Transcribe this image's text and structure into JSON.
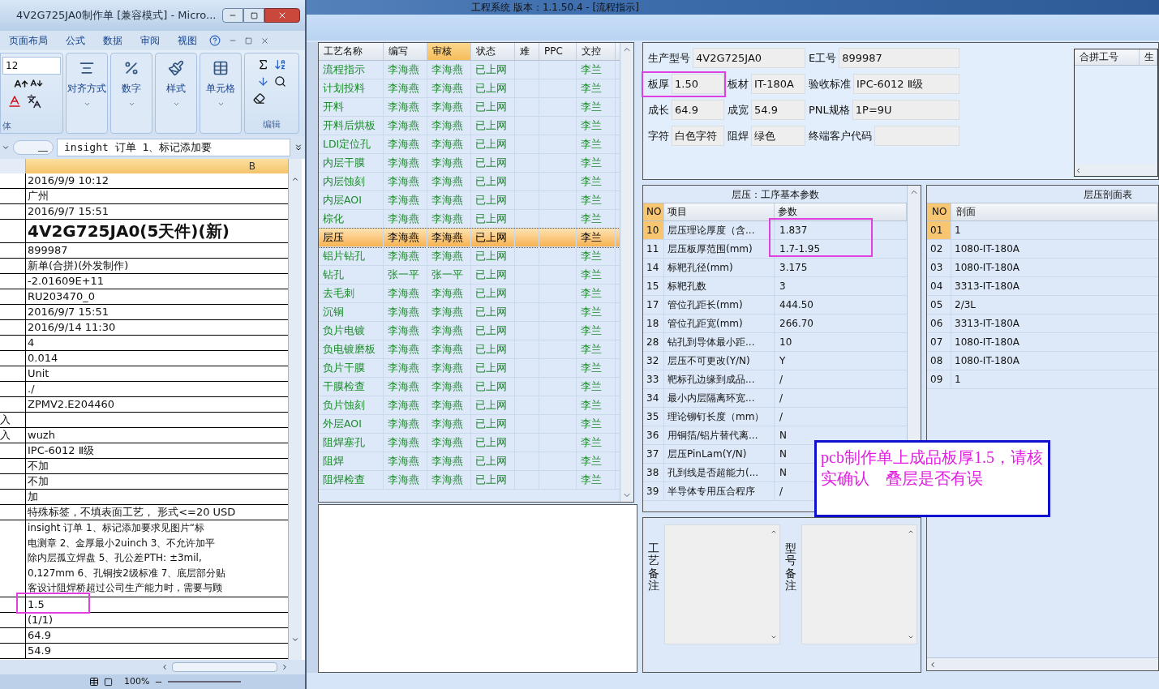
{
  "app": {
    "title": "工程系统   版本：1.1.50.4 - [流程指示]"
  },
  "excel": {
    "title": "4V2G725JA0制作单  [兼容模式]  - Micro...",
    "ribbon_tabs": [
      "页面布局",
      "公式",
      "数据",
      "审阅",
      "视图"
    ],
    "font_size": "12",
    "font_group_label": "体",
    "groups": [
      "对齐方式",
      "数字",
      "样式",
      "单元格"
    ],
    "edit_group_label": "编辑",
    "formula": "insight 订单    1、标记添加要",
    "column_header": "B",
    "zoom": "100%",
    "rows": [
      {
        "kind": "normal",
        "b": "2016/9/9 10:12"
      },
      {
        "kind": "normal",
        "b": "广州"
      },
      {
        "kind": "normal",
        "b": "2016/9/7 15:51"
      },
      {
        "kind": "big",
        "b": "4V2G725JA0(5天件)(新)"
      },
      {
        "kind": "normal",
        "b": "899987"
      },
      {
        "kind": "normal",
        "b": "新单(合拼)(外发制作)"
      },
      {
        "kind": "normal",
        "b": "-2.01609E+11"
      },
      {
        "kind": "normal",
        "b": "RU203470_0"
      },
      {
        "kind": "normal",
        "b": "2016/9/7 15:51"
      },
      {
        "kind": "normal",
        "b": "2016/9/14 11:30"
      },
      {
        "kind": "normal",
        "b": "4"
      },
      {
        "kind": "normal",
        "b": "0.014"
      },
      {
        "kind": "normal",
        "b": "Unit"
      },
      {
        "kind": "normal",
        "b": "./"
      },
      {
        "kind": "normal",
        "b": "ZPMV2.E204460"
      },
      {
        "kind": "normal",
        "a": "入"
      },
      {
        "kind": "normal",
        "a": "入",
        "b": "wuzh"
      },
      {
        "kind": "normal",
        "b": "IPC-6012 Ⅱ级"
      },
      {
        "kind": "normal",
        "b": "不加"
      },
      {
        "kind": "normal",
        "b": "不加"
      },
      {
        "kind": "normal",
        "b": "加"
      },
      {
        "kind": "normal",
        "b": "特殊标签，不填表面工艺，  形式<=20 USD"
      },
      {
        "kind": "multi",
        "lines": [
          "insight 订单    1、标记添加要求见图片“标",
          "电测章  2、金厚最小2uinch  3、不允许加平",
          "除内层孤立焊盘  5、孔公差PTH: ±3mil,",
          "0,127mm  6、孔铜按2级标准  7、底层部分贴",
          "客设计阻焊桥超过公司生产能力时，需要与顾"
        ]
      },
      {
        "kind": "normal",
        "b": "1.5"
      },
      {
        "kind": "normal",
        "b": "(1/1)"
      },
      {
        "kind": "normal",
        "b": "64.9"
      },
      {
        "kind": "normal",
        "b": "54.9"
      }
    ]
  },
  "process_table": {
    "columns": [
      {
        "label": "工艺名称",
        "highlighted": false
      },
      {
        "label": "编写",
        "highlighted": false
      },
      {
        "label": "审核",
        "highlighted": true
      },
      {
        "label": "状态",
        "highlighted": false
      },
      {
        "label": "难",
        "highlighted": false
      },
      {
        "label": "PPC",
        "highlighted": false
      },
      {
        "label": "文控",
        "highlighted": false
      }
    ],
    "rows": [
      {
        "name": "流程指示",
        "writer": "李海燕",
        "reviewer": "李海燕",
        "status": "已上网",
        "doc_control": "李兰",
        "selected": false
      },
      {
        "name": "计划投料",
        "writer": "李海燕",
        "reviewer": "李海燕",
        "status": "已上网",
        "doc_control": "李兰",
        "selected": false
      },
      {
        "name": "开料",
        "writer": "李海燕",
        "reviewer": "李海燕",
        "status": "已上网",
        "doc_control": "李兰",
        "selected": false
      },
      {
        "name": "开料后烘板",
        "writer": "李海燕",
        "reviewer": "李海燕",
        "status": "已上网",
        "doc_control": "李兰",
        "selected": false
      },
      {
        "name": "LDI定位孔",
        "writer": "李海燕",
        "reviewer": "李海燕",
        "status": "已上网",
        "doc_control": "李兰",
        "selected": false
      },
      {
        "name": "内层干膜",
        "writer": "李海燕",
        "reviewer": "李海燕",
        "status": "已上网",
        "doc_control": "李兰",
        "selected": false
      },
      {
        "name": "内层蚀刻",
        "writer": "李海燕",
        "reviewer": "李海燕",
        "status": "已上网",
        "doc_control": "李兰",
        "selected": false
      },
      {
        "name": "内层AOI",
        "writer": "李海燕",
        "reviewer": "李海燕",
        "status": "已上网",
        "doc_control": "李兰",
        "selected": false
      },
      {
        "name": "棕化",
        "writer": "李海燕",
        "reviewer": "李海燕",
        "status": "已上网",
        "doc_control": "李兰",
        "selected": false
      },
      {
        "name": "层压",
        "writer": "李海燕",
        "reviewer": "李海燕",
        "status": "已上网",
        "doc_control": "李兰",
        "selected": true
      },
      {
        "name": "铝片钻孔",
        "writer": "李海燕",
        "reviewer": "李海燕",
        "status": "已上网",
        "doc_control": "李兰",
        "selected": false
      },
      {
        "name": "钻孔",
        "writer": "张一平",
        "reviewer": "张一平",
        "status": "已上网",
        "doc_control": "李兰",
        "selected": false
      },
      {
        "name": "去毛刺",
        "writer": "李海燕",
        "reviewer": "李海燕",
        "status": "已上网",
        "doc_control": "李兰",
        "selected": false
      },
      {
        "name": "沉铜",
        "writer": "李海燕",
        "reviewer": "李海燕",
        "status": "已上网",
        "doc_control": "李兰",
        "selected": false
      },
      {
        "name": "负片电镀",
        "writer": "李海燕",
        "reviewer": "李海燕",
        "status": "已上网",
        "doc_control": "李兰",
        "selected": false
      },
      {
        "name": "负电镀磨板",
        "writer": "李海燕",
        "reviewer": "李海燕",
        "status": "已上网",
        "doc_control": "李兰",
        "selected": false
      },
      {
        "name": "负片干膜",
        "writer": "李海燕",
        "reviewer": "李海燕",
        "status": "已上网",
        "doc_control": "李兰",
        "selected": false
      },
      {
        "name": "干膜检查",
        "writer": "李海燕",
        "reviewer": "李海燕",
        "status": "已上网",
        "doc_control": "李兰",
        "selected": false
      },
      {
        "name": "负片蚀刻",
        "writer": "李海燕",
        "reviewer": "李海燕",
        "status": "已上网",
        "doc_control": "李兰",
        "selected": false
      },
      {
        "name": "外层AOI",
        "writer": "李海燕",
        "reviewer": "李海燕",
        "status": "已上网",
        "doc_control": "李兰",
        "selected": false
      },
      {
        "name": "阻焊塞孔",
        "writer": "李海燕",
        "reviewer": "李海燕",
        "status": "已上网",
        "doc_control": "李兰",
        "selected": false
      },
      {
        "name": "阻焊",
        "writer": "李海燕",
        "reviewer": "李海燕",
        "status": "已上网",
        "doc_control": "李兰",
        "selected": false
      },
      {
        "name": "阻焊检查",
        "writer": "李海燕",
        "reviewer": "李海燕",
        "status": "已上网",
        "doc_control": "李兰",
        "selected": false
      }
    ]
  },
  "product_form": {
    "fields": [
      {
        "label": "生产型号",
        "value": "4V2G725JA0"
      },
      {
        "label": "E工号",
        "value": "899987"
      },
      {
        "label": "板厚",
        "value": "1.50"
      },
      {
        "label": "板材",
        "value": "IT-180A"
      },
      {
        "label": "验收标准",
        "value": "IPC-6012 Ⅱ级"
      },
      {
        "label": "成长",
        "value": "64.9"
      },
      {
        "label": "成宽",
        "value": "54.9"
      },
      {
        "label": "PNL规格",
        "value": "1P=9U"
      },
      {
        "label": "字符",
        "value": "白色字符"
      },
      {
        "label": "阻焊",
        "value": "绿色"
      },
      {
        "label": "终端客户代码"
      }
    ],
    "merge_table": {
      "columns": [
        "合拼工号",
        "生"
      ]
    }
  },
  "param_table": {
    "title": "层压：工序基本参数",
    "columns": [
      "NO",
      "项目",
      "参数"
    ],
    "rows": [
      {
        "no": "10",
        "item": "层压理论厚度（含...",
        "value": "1.837",
        "selected": true
      },
      {
        "no": "11",
        "item": "层压板厚范围(mm)",
        "value": "1.7-1.95",
        "selected": false
      },
      {
        "no": "14",
        "item": "标靶孔径(mm)",
        "value": "3.175",
        "selected": false
      },
      {
        "no": "15",
        "item": "标靶孔数",
        "value": "3",
        "selected": false
      },
      {
        "no": "17",
        "item": "管位孔距长(mm)",
        "value": "444.50",
        "selected": false
      },
      {
        "no": "18",
        "item": "管位孔距宽(mm)",
        "value": "266.70",
        "selected": false
      },
      {
        "no": "28",
        "item": "钻孔到导体最小距...",
        "value": "10",
        "selected": false
      },
      {
        "no": "32",
        "item": "层压不可更改(Y/N)",
        "value": "Y",
        "selected": false
      },
      {
        "no": "33",
        "item": "靶标孔边缘到成品...",
        "value": "/",
        "selected": false
      },
      {
        "no": "34",
        "item": "最小内层隔离环宽...",
        "value": "/",
        "selected": false
      },
      {
        "no": "35",
        "item": "理论铆钉长度（mm）",
        "value": "/",
        "selected": false
      },
      {
        "no": "36",
        "item": "用铜箔/铝片替代离...",
        "value": "N",
        "selected": false
      },
      {
        "no": "37",
        "item": "层压PinLam(Y/N)",
        "value": "N",
        "selected": false
      },
      {
        "no": "38",
        "item": "孔到线是否超能力(...",
        "value": "N",
        "selected": false
      },
      {
        "no": "39",
        "item": "半导体专用压合程序",
        "value": "/",
        "selected": false
      }
    ]
  },
  "remarks": [
    {
      "label": "工艺备注"
    },
    {
      "label": "型号备注"
    }
  ],
  "section_table": {
    "title": "层压剖面表",
    "columns": [
      "NO",
      "剖面"
    ],
    "rows": [
      {
        "no": "01",
        "layer": "1",
        "selected": true
      },
      {
        "no": "02",
        "layer": "1080-IT-180A",
        "selected": false
      },
      {
        "no": "03",
        "layer": "1080-IT-180A",
        "selected": false
      },
      {
        "no": "04",
        "layer": "3313-IT-180A",
        "selected": false
      },
      {
        "no": "05",
        "layer": "2/3L",
        "selected": false
      },
      {
        "no": "06",
        "layer": "3313-IT-180A",
        "selected": false
      },
      {
        "no": "07",
        "layer": "1080-IT-180A",
        "selected": false
      },
      {
        "no": "08",
        "layer": "1080-IT-180A",
        "selected": false
      },
      {
        "no": "09",
        "layer": "1",
        "selected": false
      }
    ]
  },
  "note": "pcb制作单上成品板厚1.5，请核实确认　叠层是否有误"
}
